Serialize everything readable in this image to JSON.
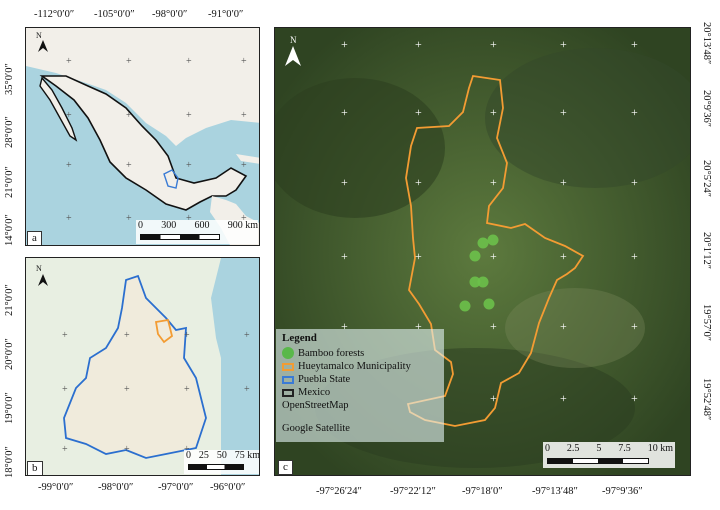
{
  "panel_a": {
    "label": "a",
    "x_ticks": [
      "-112°0′0″",
      "-105°0′0″",
      "-98°0′0″",
      "-91°0′0″"
    ],
    "y_ticks": [
      "35°0′0″",
      "28°0′0″",
      "21°0′0″",
      "14°0′0″"
    ],
    "scale": {
      "labels": [
        "0",
        "300",
        "600",
        "900 km"
      ]
    }
  },
  "panel_b": {
    "label": "b",
    "x_ticks": [
      "-99°0′0″",
      "-98°0′0″",
      "-97°0′0″",
      "-96°0′0″"
    ],
    "y_ticks": [
      "21°0′0″",
      "20°0′0″",
      "19°0′0″",
      "18°0′0″"
    ],
    "scale": {
      "labels": [
        "0",
        "25",
        "50",
        "75 km"
      ]
    }
  },
  "panel_c": {
    "label": "c",
    "x_ticks": [
      "-97°26′24″",
      "-97°22′12″",
      "-97°18′0″",
      "-97°13′48″",
      "-97°9′36″"
    ],
    "y_ticks": [
      "20°13′48″",
      "20°9′36″",
      "20°5′24″",
      "20°1′12″",
      "19°57′0″",
      "19°52′48″"
    ],
    "scale": {
      "labels": [
        "0",
        "2.5",
        "5",
        "7.5",
        "10 km"
      ]
    }
  },
  "north_arrow": {
    "label": "N"
  },
  "legend": {
    "title": "Legend",
    "items": [
      {
        "label": "Bamboo forests",
        "color": "#5ab84a"
      },
      {
        "label": "Hueytamalco Municipality",
        "color": "#f39c33"
      },
      {
        "label": "Puebla State",
        "color": "#3a7bd5"
      },
      {
        "label": "Mexico",
        "color": "#222222"
      }
    ],
    "basemaps": [
      "OpenStreetMap",
      "Google Satellite"
    ]
  }
}
